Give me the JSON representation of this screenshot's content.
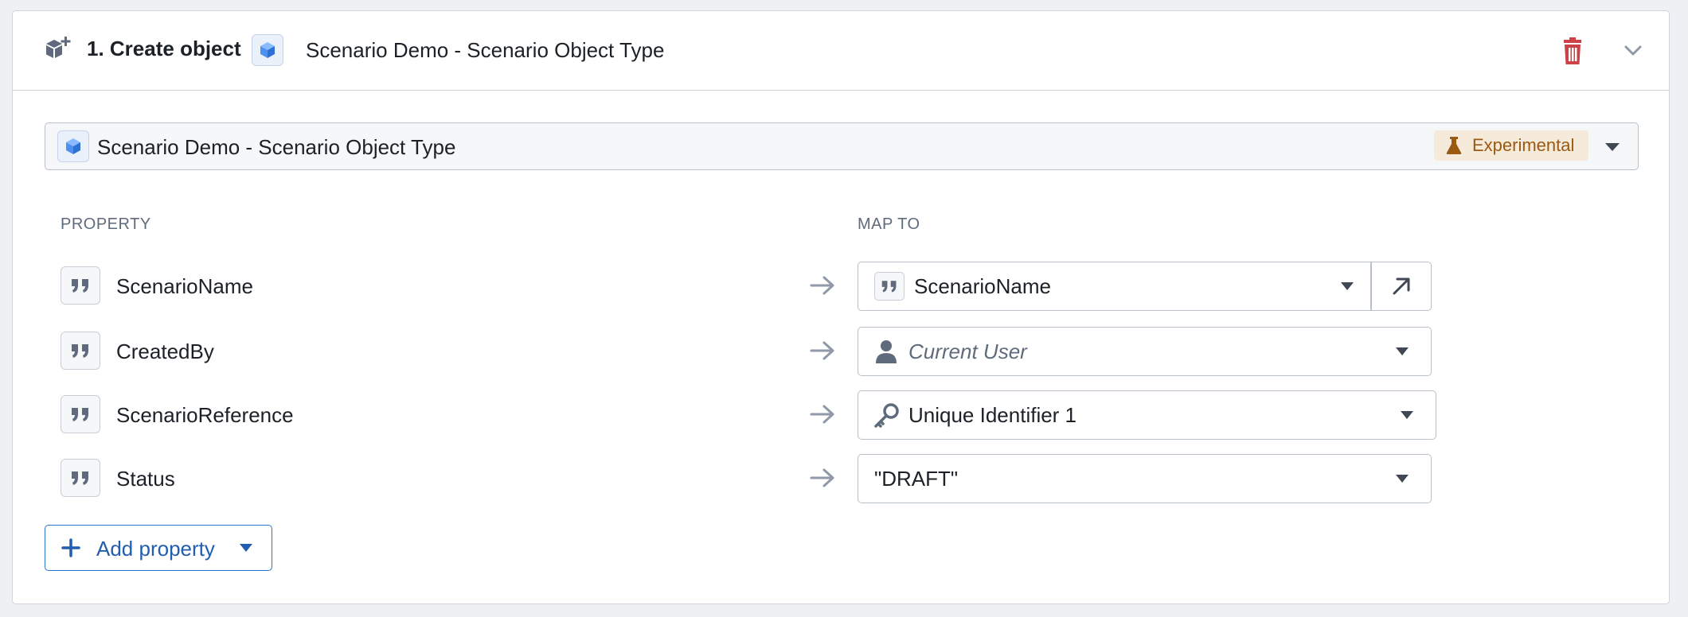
{
  "header": {
    "title": "1. Create object",
    "object_type_name": "Scenario Demo - Scenario Object Type"
  },
  "type_select": {
    "value": "Scenario Demo - Scenario Object Type",
    "badge": "Experimental"
  },
  "columns": {
    "property": "PROPERTY",
    "map_to": "MAP TO"
  },
  "rows": [
    {
      "property": "ScenarioName",
      "map_value": "ScenarioName",
      "map_icon": "quote-icon"
    },
    {
      "property": "CreatedBy",
      "map_value": "Current User",
      "map_icon": "user-icon"
    },
    {
      "property": "ScenarioReference",
      "map_value": "Unique Identifier 1",
      "map_icon": "key-icon"
    },
    {
      "property": "Status",
      "map_value": "\"DRAFT\"",
      "map_icon": ""
    }
  ],
  "add_property_label": "Add property",
  "colors": {
    "primary": "#2d72d2",
    "danger": "#cd4246",
    "badge_bg": "#f6eadb",
    "badge_text": "#9a5a12",
    "object_icon": "#4c90f0"
  }
}
